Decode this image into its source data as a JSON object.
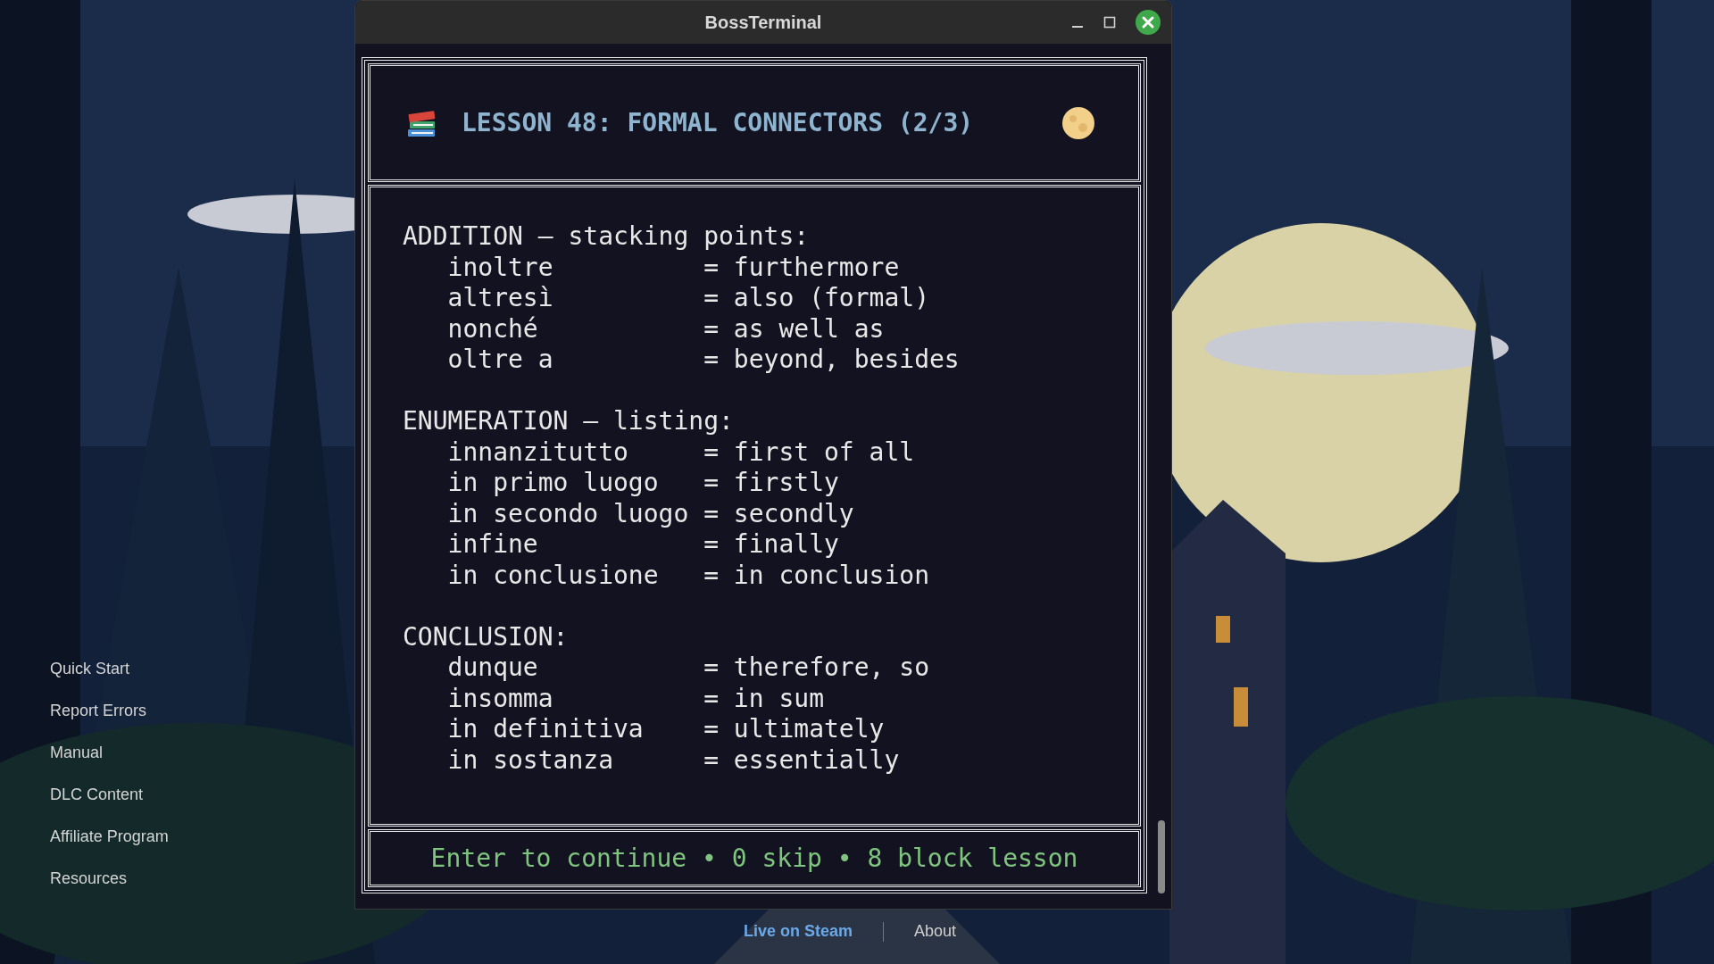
{
  "window": {
    "title": "BossTerminal"
  },
  "lesson": {
    "title": "LESSON 48: FORMAL CONNECTORS (2/3)"
  },
  "sections": [
    {
      "heading": "ADDITION — stacking points:",
      "lines": [
        "inoltre          = furthermore",
        "altresì          = also (formal)",
        "nonché           = as well as",
        "oltre a          = beyond, besides"
      ]
    },
    {
      "heading": "ENUMERATION — listing:",
      "lines": [
        "innanzitutto     = first of all",
        "in primo luogo   = firstly",
        "in secondo luogo = secondly",
        "infine           = finally",
        "in conclusione   = in conclusion"
      ]
    },
    {
      "heading": "CONCLUSION:",
      "lines": [
        "dunque           = therefore, so",
        "insomma          = in sum",
        "in definitiva    = ultimately",
        "in sostanza      = essentially"
      ]
    }
  ],
  "footer": {
    "hint": "Enter to continue • 0 skip • 8 block lesson"
  },
  "sidebar": {
    "items": [
      "Quick Start",
      "Report Errors",
      "Manual",
      "DLC Content",
      "Affiliate Program",
      "Resources"
    ]
  },
  "bottom_links": [
    {
      "label": "Live on Steam",
      "kind": "accent"
    },
    {
      "label": "About",
      "kind": "plain"
    }
  ]
}
